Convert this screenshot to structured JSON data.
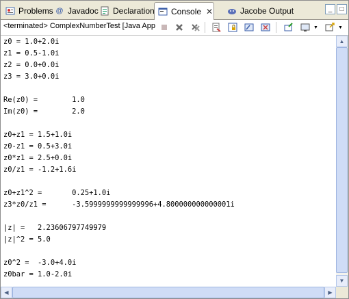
{
  "tabs": [
    {
      "label": "Problems",
      "icon": "problems-icon",
      "active": false
    },
    {
      "label": "Javadoc",
      "icon": "at-icon",
      "active": false
    },
    {
      "label": "Declaration",
      "icon": "declaration-icon",
      "active": false
    },
    {
      "label": "Console",
      "icon": "console-icon",
      "active": true,
      "close": "✕"
    },
    {
      "label": "Jacobe Output",
      "icon": "jacobe-icon",
      "active": false
    }
  ],
  "window_buttons": {
    "minimize": "_",
    "maximize": "□"
  },
  "console": {
    "status": "<terminated> ComplexNumberTest [Java Application]",
    "lines": [
      "z0 = 1.0+2.0i",
      "z1 = 0.5-1.0i",
      "z2 = 0.0+0.0i",
      "z3 = 3.0+0.0i",
      "",
      "Re(z0) =        1.0",
      "Im(z0) =        2.0",
      "",
      "z0+z1 = 1.5+1.0i",
      "z0-z1 = 0.5+3.0i",
      "z0*z1 = 2.5+0.0i",
      "z0/z1 = -1.2+1.6i",
      "",
      "z0+z1^2 =       0.25+1.0i",
      "z3*z0/z1 =      -3.5999999999999996+4.800000000000001i",
      "",
      "|z| =   2.23606797749979",
      "|z|^2 = 5.0",
      "",
      "z0^2 =  -3.0+4.0i",
      "z0bar = 1.0-2.0i"
    ]
  },
  "scrollbar": {
    "up": "▲",
    "down": "▼",
    "left": "◀",
    "right": "▶"
  }
}
